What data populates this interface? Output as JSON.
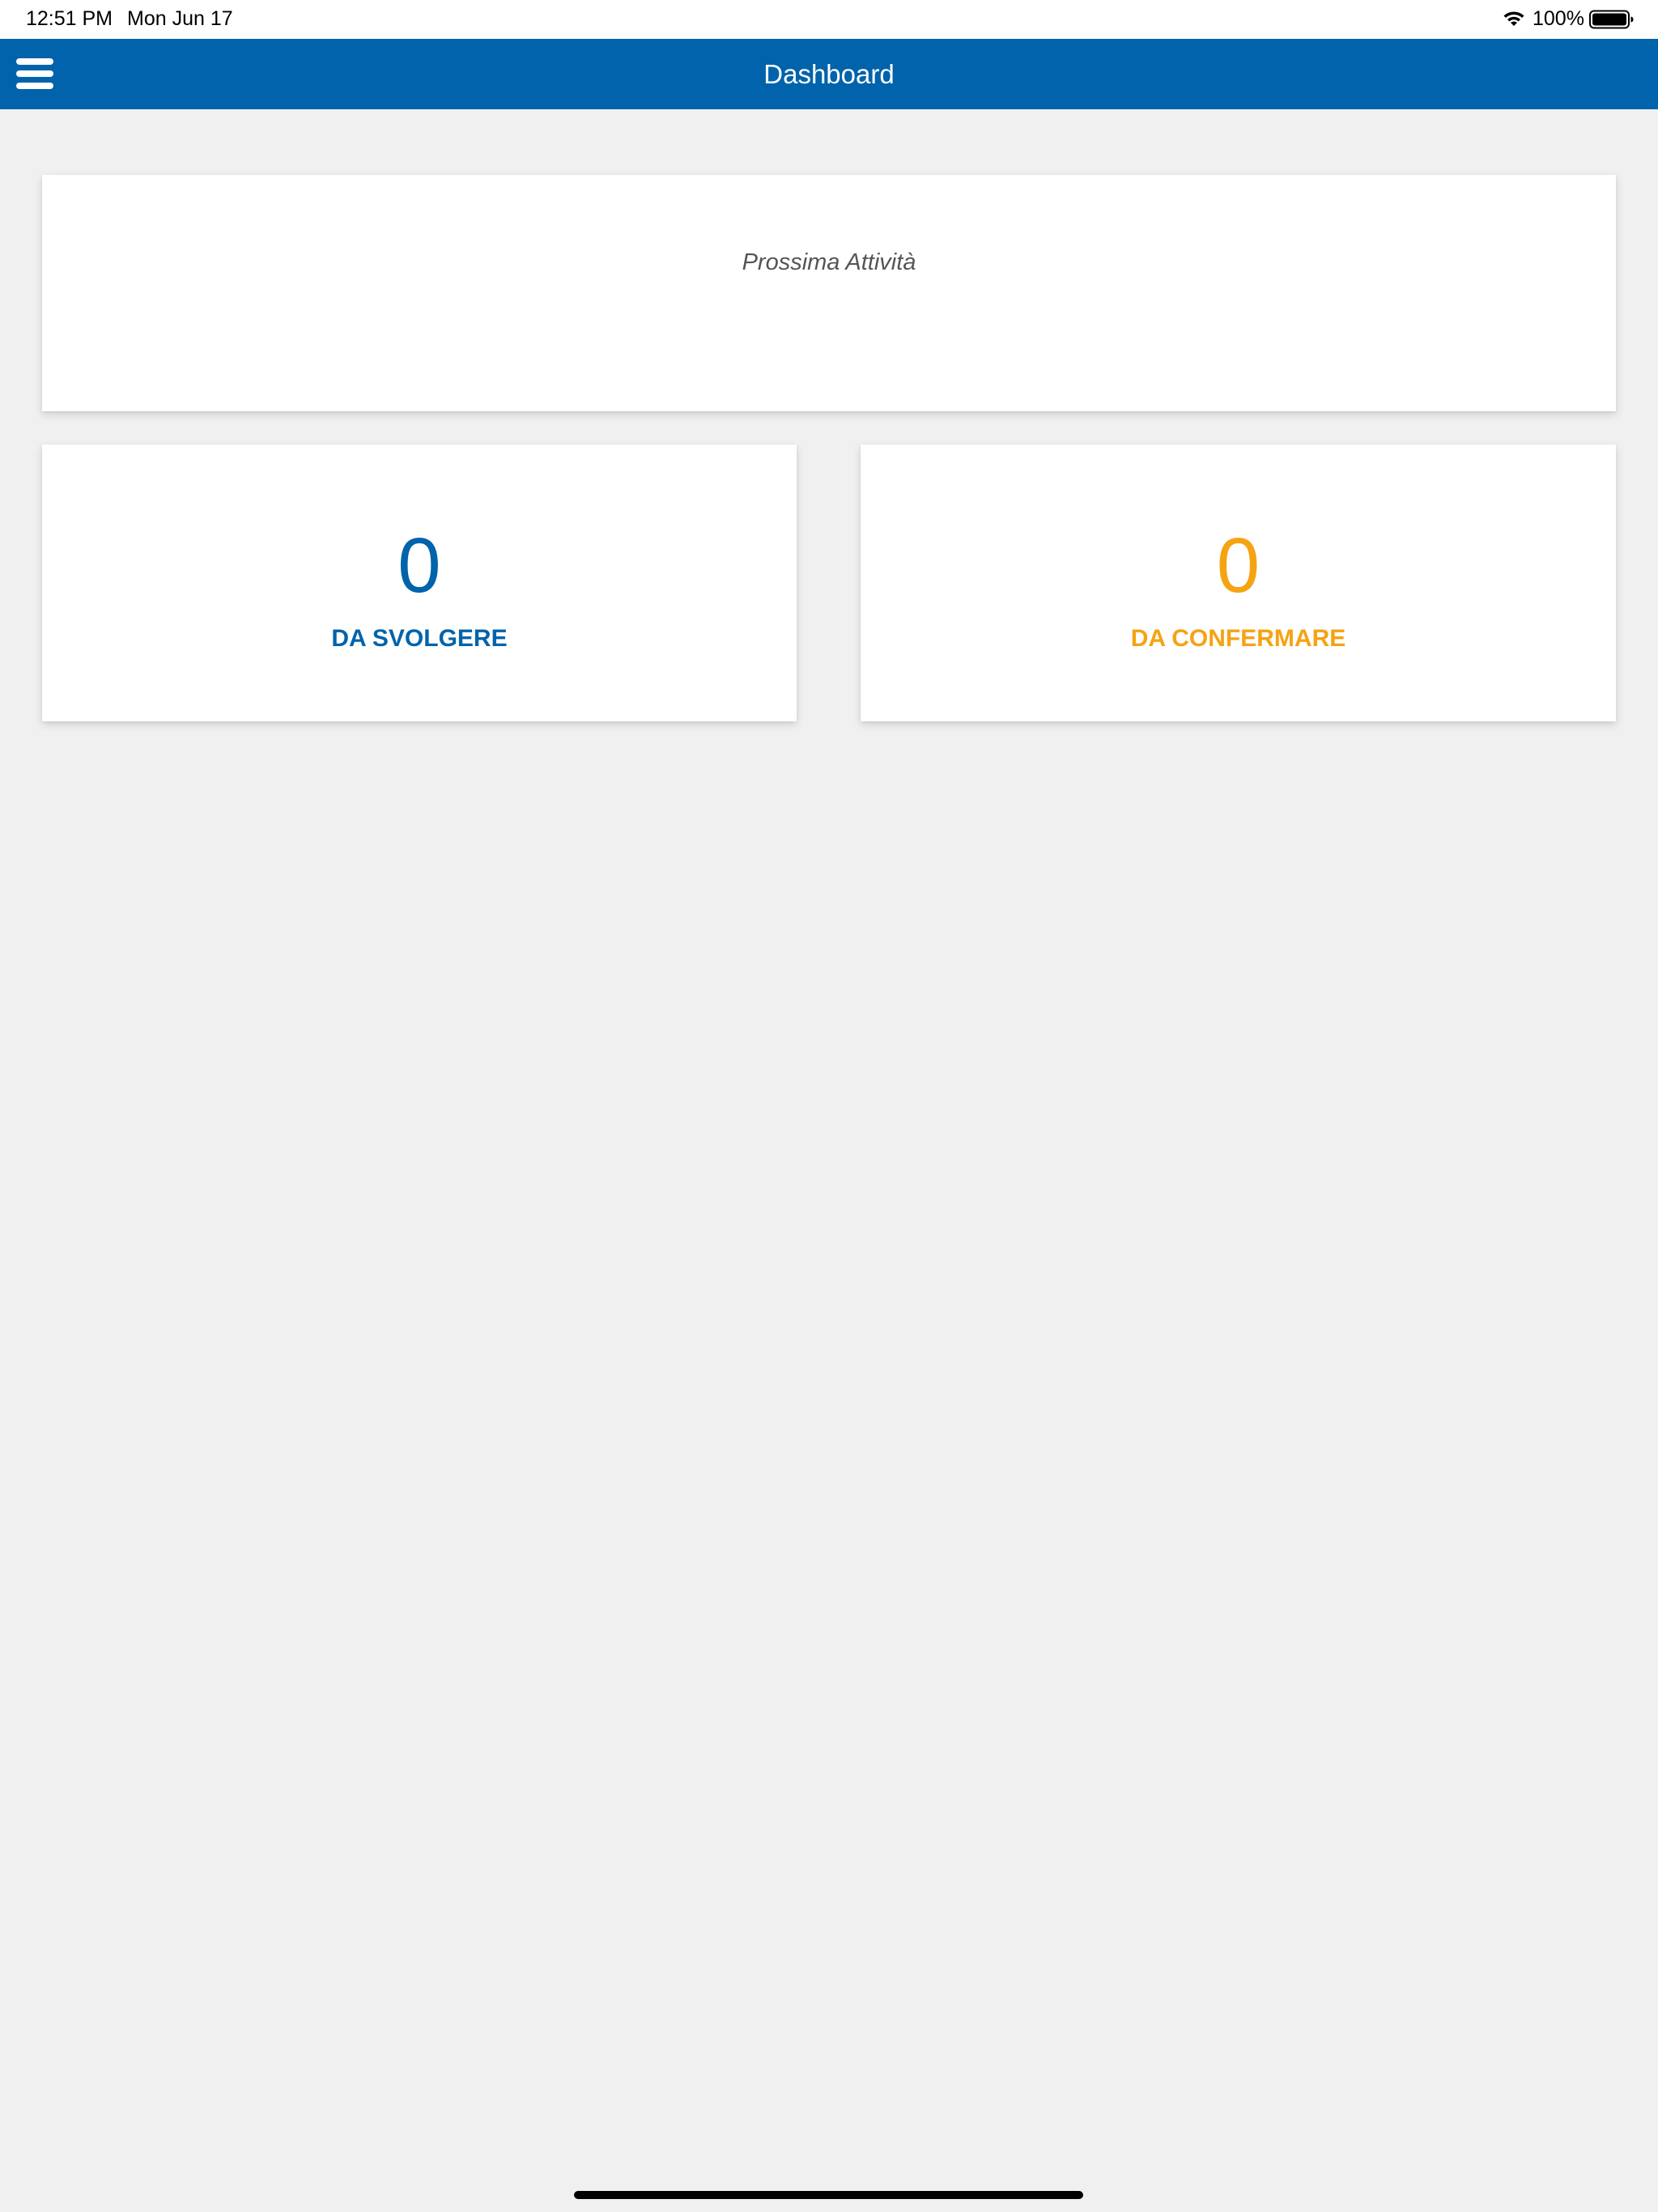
{
  "status_bar": {
    "time": "12:51 PM",
    "date": "Mon Jun 17",
    "battery_percent": "100%",
    "icons": [
      "wifi-icon",
      "battery-icon"
    ]
  },
  "header": {
    "title": "Dashboard",
    "menu_icon": "hamburger-menu-icon",
    "color": "#0063ab"
  },
  "next_activity": {
    "label": "Prossima Attività"
  },
  "counters": {
    "to_do": {
      "value": "0",
      "label": "DA SVOLGERE",
      "color": "#0063ab"
    },
    "to_confirm": {
      "value": "0",
      "label": "DA CONFERMARE",
      "color": "#f5a313"
    }
  },
  "colors": {
    "background": "#f0f0f0",
    "card": "#ffffff"
  }
}
